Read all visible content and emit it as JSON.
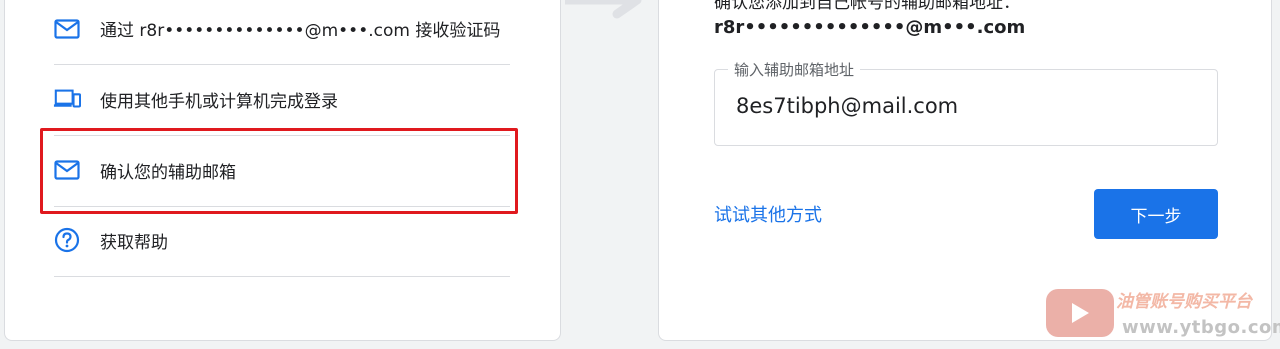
{
  "left_panel": {
    "options": [
      {
        "icon": "mail-icon",
        "label": "通过 r8r••••••••••••••@m•••.com 接收验证码"
      },
      {
        "icon": "devices-icon",
        "label": "使用其他手机或计算机完成登录"
      },
      {
        "icon": "mail-icon",
        "label": "确认您的辅助邮箱"
      },
      {
        "icon": "help-circle-icon",
        "label": "获取帮助"
      }
    ]
  },
  "right_panel": {
    "instruction_clipped": "确认您添加到自己帐号的辅助邮箱地址：",
    "masked_email": "r8r••••••••••••••@m•••.com",
    "recovery_field": {
      "label": "输入辅助邮箱地址",
      "value": "8es7tibph@mail.com"
    },
    "try_another_way": "试试其他方式",
    "next_button": "下一步"
  },
  "watermark": {
    "title": "油管账号购买平台",
    "url": "www.ytbgo.com"
  },
  "colors": {
    "accent": "#1a73e8",
    "highlight": "#e0191e",
    "divider": "#dadce0",
    "background": "#f1f3f4"
  }
}
